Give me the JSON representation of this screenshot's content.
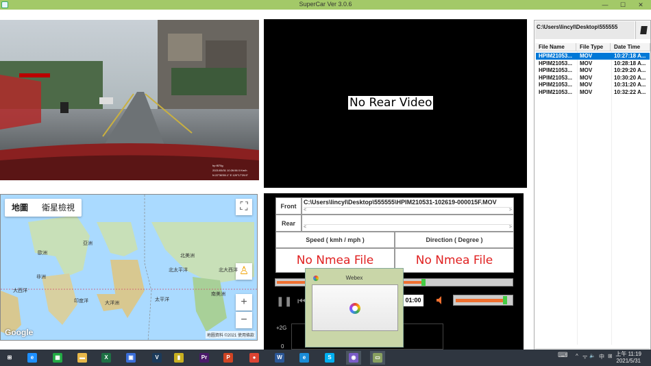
{
  "window": {
    "title": "SuperCar  Ver 3.0.6",
    "minimize": "—",
    "maximize": "☐",
    "close": "✕"
  },
  "front_video": {
    "overlay_line1": "hp f870g",
    "overlay_line2": "2021/05/31 10:26:56  0 Km/h",
    "overlay_line3": "N 22°36'55.1\"  E 120°17'29.5\"",
    "plate_text": "██ ███"
  },
  "rear_video": {
    "message": "No Rear Video"
  },
  "map": {
    "tabs": [
      "地圖",
      "衛星檢視"
    ],
    "fullscreen_glyph": "⛶",
    "pegman_glyph": "♙",
    "zoom_in": "+",
    "zoom_out": "−",
    "google": "Google",
    "footer": "地圖資料 ©2021   使用條款",
    "labels": [
      "歐洲",
      "亞洲",
      "北美洲",
      "非洲",
      "南美洲",
      "大洋洲",
      "印度洋",
      "太平洋",
      "北太平洋",
      "大西洋",
      "北大西洋"
    ]
  },
  "panel": {
    "front_label": "Front",
    "rear_label": "Rear",
    "front_path": "C:\\Users\\lincyl\\Desktop\\555555\\HPIM210531-102619-000015F.MOV",
    "rear_path": "",
    "scroll_left": "<",
    "scroll_right": ">",
    "speed_header": "Speed ( kmh / mph )",
    "direction_header": "Direction ( Degree )",
    "speed_value": "No Nmea File",
    "direction_value": "No Nmea File",
    "progress": 0.62,
    "volume": 0.9,
    "pause_glyph": "❚❚",
    "prev_glyph": "⏮",
    "time": "01:00",
    "gsensor_label_top": "+2G",
    "gsensor_label_zero": "0",
    "accent_orange": "#f07030",
    "accent_green": "#44cc44"
  },
  "popup": {
    "title": "Webex"
  },
  "filelist": {
    "path": "C:\\Users\\lincyl\\Desktop\\555555",
    "columns": [
      "File Name",
      "File Type",
      "Date Time"
    ],
    "rows": [
      {
        "name": "HPIM21053...",
        "type": "MOV",
        "time": "10:27:18 A...",
        "selected": true
      },
      {
        "name": "HPIM21053...",
        "type": "MOV",
        "time": "10:28:18 A...",
        "selected": false
      },
      {
        "name": "HPIM21053...",
        "type": "MOV",
        "time": "10:29:20 A...",
        "selected": false
      },
      {
        "name": "HPIM21053...",
        "type": "MOV",
        "time": "10:30:20 A...",
        "selected": false
      },
      {
        "name": "HPIM21053...",
        "type": "MOV",
        "time": "10:31:20 A...",
        "selected": false
      },
      {
        "name": "HPIM21053...",
        "type": "MOV",
        "time": "10:32:22 A...",
        "selected": false
      }
    ],
    "scroll_left": "◀",
    "scroll_right": "▶"
  },
  "taskbar": {
    "apps": [
      {
        "name": "start",
        "glyph": "⊞",
        "color": "#2f3640"
      },
      {
        "name": "ie",
        "glyph": "e",
        "color": "#1e90ff"
      },
      {
        "name": "store",
        "glyph": "▦",
        "color": "#22aa44"
      },
      {
        "name": "explorer",
        "glyph": "▬",
        "color": "#e8b84a"
      },
      {
        "name": "excel",
        "glyph": "X",
        "color": "#1d7044"
      },
      {
        "name": "remote",
        "glyph": "▣",
        "color": "#3a6ed8"
      },
      {
        "name": "vegas",
        "glyph": "V",
        "color": "#1b3a5a"
      },
      {
        "name": "lock",
        "glyph": "▮",
        "color": "#c8b020"
      },
      {
        "name": "premiere",
        "glyph": "Pr",
        "color": "#4a1a6a"
      },
      {
        "name": "powerpoint",
        "glyph": "P",
        "color": "#d04423"
      },
      {
        "name": "chrome",
        "glyph": "●",
        "color": "#dd4433"
      },
      {
        "name": "word",
        "glyph": "W",
        "color": "#2b5797"
      },
      {
        "name": "edge",
        "glyph": "e",
        "color": "#1a8cd8"
      },
      {
        "name": "skype",
        "glyph": "S",
        "color": "#00aff0"
      },
      {
        "name": "webex",
        "glyph": "◉",
        "color": "#7a5cc8"
      },
      {
        "name": "supercar",
        "glyph": "▭",
        "color": "#88a060"
      }
    ],
    "tray_keyboard": "⌨",
    "tray_up": "^",
    "tray_network": "ᯤ",
    "tray_volume": "🔈",
    "tray_lang": "中",
    "tray_ime": "⊞",
    "clock_time": "上午 11:19",
    "clock_date": "2021/5/31"
  }
}
